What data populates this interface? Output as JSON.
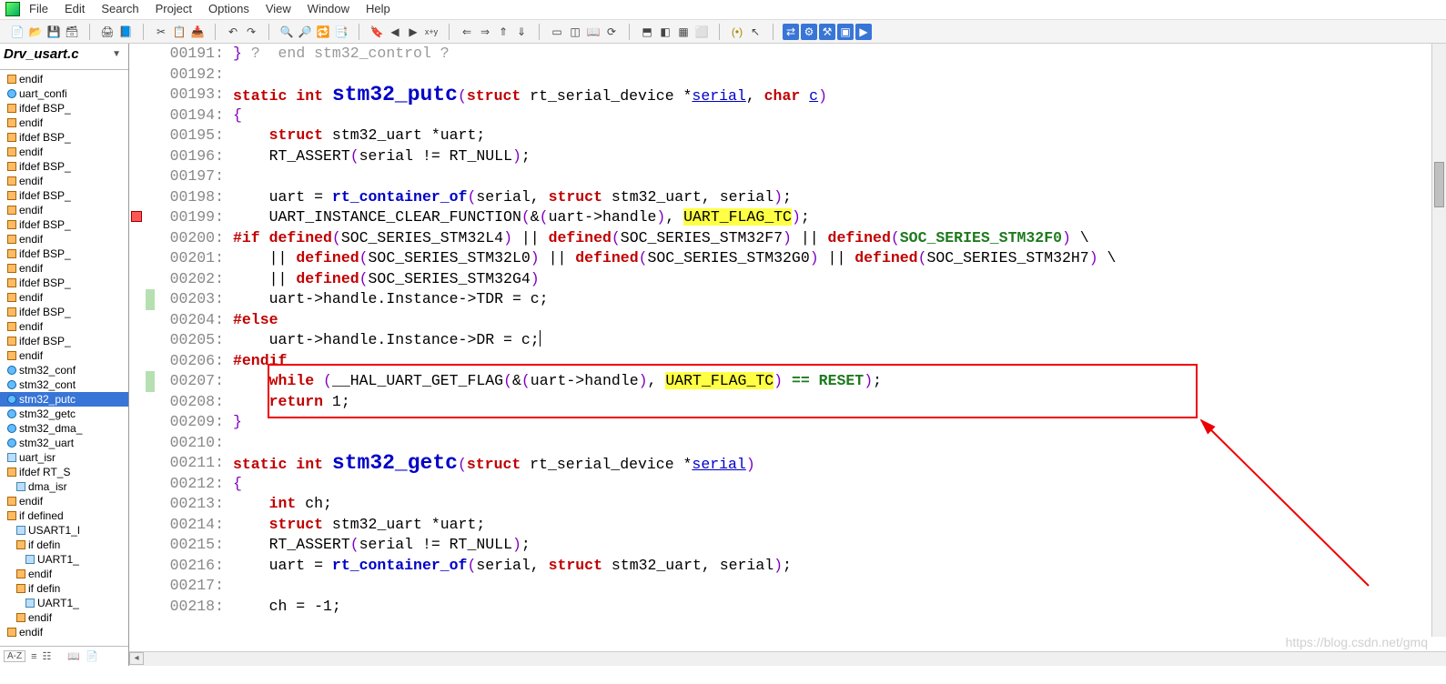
{
  "menu": {
    "file": "File",
    "edit": "Edit",
    "search": "Search",
    "project": "Project",
    "options": "Options",
    "view": "View",
    "window": "Window",
    "help": "Help"
  },
  "filetab": "Drv_usart.c",
  "sidebar": {
    "items": [
      {
        "icon": "block",
        "label": "endif",
        "indent": 0
      },
      {
        "icon": "func",
        "label": "uart_confi",
        "indent": 0
      },
      {
        "icon": "block",
        "label": "ifdef BSP_",
        "indent": 0
      },
      {
        "icon": "block",
        "label": "endif",
        "indent": 0
      },
      {
        "icon": "block",
        "label": "ifdef BSP_",
        "indent": 0
      },
      {
        "icon": "block",
        "label": "endif",
        "indent": 0
      },
      {
        "icon": "block",
        "label": "ifdef BSP_",
        "indent": 0
      },
      {
        "icon": "block",
        "label": "endif",
        "indent": 0
      },
      {
        "icon": "block",
        "label": "ifdef BSP_",
        "indent": 0
      },
      {
        "icon": "block",
        "label": "endif",
        "indent": 0
      },
      {
        "icon": "block",
        "label": "ifdef BSP_",
        "indent": 0
      },
      {
        "icon": "block",
        "label": "endif",
        "indent": 0
      },
      {
        "icon": "block",
        "label": "ifdef BSP_",
        "indent": 0
      },
      {
        "icon": "block",
        "label": "endif",
        "indent": 0
      },
      {
        "icon": "block",
        "label": "ifdef BSP_",
        "indent": 0
      },
      {
        "icon": "block",
        "label": "endif",
        "indent": 0
      },
      {
        "icon": "block",
        "label": "ifdef BSP_",
        "indent": 0
      },
      {
        "icon": "block",
        "label": "endif",
        "indent": 0
      },
      {
        "icon": "block",
        "label": "ifdef BSP_",
        "indent": 0
      },
      {
        "icon": "block",
        "label": "endif",
        "indent": 0
      },
      {
        "icon": "func",
        "label": "stm32_conf",
        "indent": 0
      },
      {
        "icon": "func",
        "label": "stm32_cont",
        "indent": 0
      },
      {
        "icon": "func",
        "label": "stm32_putc",
        "indent": 0,
        "selected": true
      },
      {
        "icon": "func",
        "label": "stm32_getc",
        "indent": 0
      },
      {
        "icon": "func",
        "label": "stm32_dma_",
        "indent": 0
      },
      {
        "icon": "func",
        "label": "stm32_uart",
        "indent": 0
      },
      {
        "icon": "type",
        "label": "uart_isr",
        "indent": 0
      },
      {
        "icon": "block",
        "label": "ifdef RT_S",
        "indent": 0
      },
      {
        "icon": "type",
        "label": "dma_isr",
        "indent": 1
      },
      {
        "icon": "block",
        "label": "endif",
        "indent": 0
      },
      {
        "icon": "block",
        "label": "if defined",
        "indent": 0
      },
      {
        "icon": "type",
        "label": "USART1_I",
        "indent": 1
      },
      {
        "icon": "block",
        "label": "if defin",
        "indent": 1
      },
      {
        "icon": "type",
        "label": "UART1_",
        "indent": 2
      },
      {
        "icon": "block",
        "label": "endif",
        "indent": 1
      },
      {
        "icon": "block",
        "label": "if defin",
        "indent": 1
      },
      {
        "icon": "type",
        "label": "UART1_",
        "indent": 2
      },
      {
        "icon": "block",
        "label": "endif",
        "indent": 1
      },
      {
        "icon": "block",
        "label": "endif",
        "indent": 0
      }
    ]
  },
  "code": {
    "lines": [
      {
        "n": "00191",
        "g": "",
        "segs": [
          {
            "t": "} ",
            "c": "br"
          },
          {
            "t": "?  end stm32_control ?",
            "c": "cmt"
          }
        ]
      },
      {
        "n": "00192",
        "g": "",
        "segs": []
      },
      {
        "n": "00193",
        "g": "",
        "segs": [
          {
            "t": "static int ",
            "c": "kw"
          },
          {
            "t": "stm32_putc",
            "c": "fnbig"
          },
          {
            "t": "(",
            "c": "br"
          },
          {
            "t": "struct",
            "c": "kw"
          },
          {
            "t": " rt_serial_device *",
            "c": "id"
          },
          {
            "t": "serial",
            "c": "ul"
          },
          {
            "t": ", ",
            "c": "id"
          },
          {
            "t": "char",
            "c": "kw"
          },
          {
            "t": " ",
            "c": "id"
          },
          {
            "t": "c",
            "c": "ul"
          },
          {
            "t": ")",
            "c": "br"
          }
        ]
      },
      {
        "n": "00194",
        "g": "",
        "segs": [
          {
            "t": "{",
            "c": "br"
          }
        ]
      },
      {
        "n": "00195",
        "g": "",
        "segs": [
          {
            "t": "    ",
            "c": "id"
          },
          {
            "t": "struct",
            "c": "kw"
          },
          {
            "t": " stm32_uart *uart;",
            "c": "id"
          }
        ]
      },
      {
        "n": "00196",
        "g": "",
        "segs": [
          {
            "t": "    RT_ASSERT",
            "c": "id"
          },
          {
            "t": "(",
            "c": "br"
          },
          {
            "t": "serial != RT_NULL",
            "c": "id"
          },
          {
            "t": ")",
            "c": "br"
          },
          {
            "t": ";",
            "c": "id"
          }
        ]
      },
      {
        "n": "00197",
        "g": "",
        "segs": []
      },
      {
        "n": "00198",
        "g": "",
        "segs": [
          {
            "t": "    uart = ",
            "c": "id"
          },
          {
            "t": "rt_container_of",
            "c": "fn"
          },
          {
            "t": "(",
            "c": "br"
          },
          {
            "t": "serial, ",
            "c": "id"
          },
          {
            "t": "struct",
            "c": "kw"
          },
          {
            "t": " stm32_uart, serial",
            "c": "id"
          },
          {
            "t": ")",
            "c": "br"
          },
          {
            "t": ";",
            "c": "id"
          }
        ]
      },
      {
        "n": "00199",
        "g": "mark",
        "segs": [
          {
            "t": "    UART_INSTANCE_CLEAR_FUNCTION",
            "c": "id"
          },
          {
            "t": "(",
            "c": "br"
          },
          {
            "t": "&",
            "c": "id"
          },
          {
            "t": "(",
            "c": "br"
          },
          {
            "t": "uart->handle",
            "c": "id"
          },
          {
            "t": ")",
            "c": "br"
          },
          {
            "t": ", ",
            "c": "id"
          },
          {
            "t": "UART_FLAG_TC",
            "c": "hl"
          },
          {
            "t": ")",
            "c": "br"
          },
          {
            "t": ";",
            "c": "id"
          }
        ]
      },
      {
        "n": "00200",
        "g": "",
        "segs": [
          {
            "t": "#if defined",
            "c": "pp"
          },
          {
            "t": "(",
            "c": "br"
          },
          {
            "t": "SOC_SERIES_STM32L4",
            "c": "id"
          },
          {
            "t": ")",
            "c": "br"
          },
          {
            "t": " || ",
            "c": "id"
          },
          {
            "t": "defined",
            "c": "pp"
          },
          {
            "t": "(",
            "c": "br"
          },
          {
            "t": "SOC_SERIES_STM32F7",
            "c": "id"
          },
          {
            "t": ")",
            "c": "br"
          },
          {
            "t": " || ",
            "c": "id"
          },
          {
            "t": "defined",
            "c": "pp"
          },
          {
            "t": "(",
            "c": "br"
          },
          {
            "t": "SOC_SERIES_STM32F0",
            "c": "const"
          },
          {
            "t": ")",
            "c": "br"
          },
          {
            "t": " \\",
            "c": "id"
          }
        ]
      },
      {
        "n": "00201",
        "g": "",
        "segs": [
          {
            "t": "    || ",
            "c": "id"
          },
          {
            "t": "defined",
            "c": "pp"
          },
          {
            "t": "(",
            "c": "br"
          },
          {
            "t": "SOC_SERIES_STM32L0",
            "c": "id"
          },
          {
            "t": ")",
            "c": "br"
          },
          {
            "t": " || ",
            "c": "id"
          },
          {
            "t": "defined",
            "c": "pp"
          },
          {
            "t": "(",
            "c": "br"
          },
          {
            "t": "SOC_SERIES_STM32G0",
            "c": "id"
          },
          {
            "t": ")",
            "c": "br"
          },
          {
            "t": " || ",
            "c": "id"
          },
          {
            "t": "defined",
            "c": "pp"
          },
          {
            "t": "(",
            "c": "br"
          },
          {
            "t": "SOC_SERIES_STM32H7",
            "c": "id"
          },
          {
            "t": ")",
            "c": "br"
          },
          {
            "t": " \\",
            "c": "id"
          }
        ]
      },
      {
        "n": "00202",
        "g": "",
        "segs": [
          {
            "t": "    || ",
            "c": "id"
          },
          {
            "t": "defined",
            "c": "pp"
          },
          {
            "t": "(",
            "c": "br"
          },
          {
            "t": "SOC_SERIES_STM32G4",
            "c": "id"
          },
          {
            "t": ")",
            "c": "br"
          }
        ]
      },
      {
        "n": "00203",
        "g": "chg",
        "segs": [
          {
            "t": "    uart->handle.Instance->TDR = c;",
            "c": "id"
          }
        ]
      },
      {
        "n": "00204",
        "g": "",
        "segs": [
          {
            "t": "#else",
            "c": "pp"
          }
        ]
      },
      {
        "n": "00205",
        "g": "",
        "segs": [
          {
            "t": "    uart->handle.Instance->DR = c;",
            "c": "id"
          },
          {
            "t": "",
            "c": "cursor"
          }
        ]
      },
      {
        "n": "00206",
        "g": "",
        "segs": [
          {
            "t": "#endif",
            "c": "pp"
          }
        ]
      },
      {
        "n": "00207",
        "g": "chg",
        "segs": [
          {
            "t": "    ",
            "c": "id"
          },
          {
            "t": "while",
            "c": "kw"
          },
          {
            "t": " ",
            "c": "id"
          },
          {
            "t": "(",
            "c": "br"
          },
          {
            "t": "__HAL_UART_GET_FLAG",
            "c": "id"
          },
          {
            "t": "(",
            "c": "br"
          },
          {
            "t": "&",
            "c": "id"
          },
          {
            "t": "(",
            "c": "br"
          },
          {
            "t": "uart->handle",
            "c": "id"
          },
          {
            "t": ")",
            "c": "br"
          },
          {
            "t": ", ",
            "c": "id"
          },
          {
            "t": "UART_FLAG_TC",
            "c": "hl"
          },
          {
            "t": ")",
            "c": "br"
          },
          {
            "t": " == RESET",
            "c": "const"
          },
          {
            "t": ")",
            "c": "br"
          },
          {
            "t": ";",
            "c": "id"
          }
        ]
      },
      {
        "n": "00208",
        "g": "",
        "segs": [
          {
            "t": "    ",
            "c": "id"
          },
          {
            "t": "return",
            "c": "kw"
          },
          {
            "t": " 1;",
            "c": "id"
          }
        ]
      },
      {
        "n": "00209",
        "g": "",
        "segs": [
          {
            "t": "}",
            "c": "br"
          }
        ]
      },
      {
        "n": "00210",
        "g": "",
        "segs": []
      },
      {
        "n": "00211",
        "g": "",
        "segs": [
          {
            "t": "static int ",
            "c": "kw"
          },
          {
            "t": "stm32_getc",
            "c": "fnbig"
          },
          {
            "t": "(",
            "c": "br"
          },
          {
            "t": "struct",
            "c": "kw"
          },
          {
            "t": " rt_serial_device *",
            "c": "id"
          },
          {
            "t": "serial",
            "c": "ul"
          },
          {
            "t": ")",
            "c": "br"
          }
        ]
      },
      {
        "n": "00212",
        "g": "",
        "segs": [
          {
            "t": "{",
            "c": "br"
          }
        ]
      },
      {
        "n": "00213",
        "g": "",
        "segs": [
          {
            "t": "    ",
            "c": "id"
          },
          {
            "t": "int",
            "c": "kw"
          },
          {
            "t": " ch;",
            "c": "id"
          }
        ]
      },
      {
        "n": "00214",
        "g": "",
        "segs": [
          {
            "t": "    ",
            "c": "id"
          },
          {
            "t": "struct",
            "c": "kw"
          },
          {
            "t": " stm32_uart *uart;",
            "c": "id"
          }
        ]
      },
      {
        "n": "00215",
        "g": "",
        "segs": [
          {
            "t": "    RT_ASSERT",
            "c": "id"
          },
          {
            "t": "(",
            "c": "br"
          },
          {
            "t": "serial != RT_NULL",
            "c": "id"
          },
          {
            "t": ")",
            "c": "br"
          },
          {
            "t": ";",
            "c": "id"
          }
        ]
      },
      {
        "n": "00216",
        "g": "",
        "segs": [
          {
            "t": "    uart = ",
            "c": "id"
          },
          {
            "t": "rt_container_of",
            "c": "fn"
          },
          {
            "t": "(",
            "c": "br"
          },
          {
            "t": "serial, ",
            "c": "id"
          },
          {
            "t": "struct",
            "c": "kw"
          },
          {
            "t": " stm32_uart, serial",
            "c": "id"
          },
          {
            "t": ")",
            "c": "br"
          },
          {
            "t": ";",
            "c": "id"
          }
        ]
      },
      {
        "n": "00217",
        "g": "",
        "segs": []
      },
      {
        "n": "00218",
        "g": "",
        "segs": [
          {
            "t": "    ch = -1;",
            "c": "id"
          }
        ]
      }
    ]
  },
  "watermark": "https://blog.csdn.net/gmq",
  "bottom_toolbar": {
    "az": "A-Z"
  }
}
